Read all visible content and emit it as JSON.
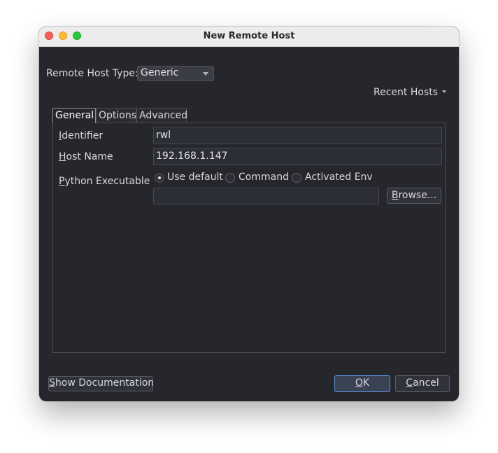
{
  "window": {
    "title": "New Remote Host"
  },
  "host_type": {
    "label_prefix": "Remote Host Type:",
    "value": "Generic"
  },
  "recent_hosts": {
    "label": "Recent Hosts"
  },
  "tabs": [
    {
      "label": "General",
      "active": true
    },
    {
      "label": "Options",
      "active": false
    },
    {
      "label": "Advanced",
      "active": false
    }
  ],
  "general": {
    "identifier": {
      "mnemonic": "I",
      "rest": "dentifier",
      "value": "rwl"
    },
    "host_name": {
      "mnemonic": "H",
      "rest": "ost Name",
      "value": "192.168.1.147"
    },
    "python_executable": {
      "mnemonic": "P",
      "rest": "ython Executable",
      "options": [
        "Use default",
        "Command",
        "Activated Env"
      ],
      "selected": "Use default",
      "path_value": ""
    },
    "browse": {
      "mnemonic": "B",
      "rest": "rowse..."
    }
  },
  "footer": {
    "show_docs": {
      "mnemonic": "S",
      "rest": "how Documentation"
    },
    "ok": {
      "mnemonic": "O",
      "rest": "K"
    },
    "cancel": {
      "mnemonic": "C",
      "rest": "ancel"
    }
  },
  "colors": {
    "window_bg": "#25272d",
    "default_button_border": "#5b8fd4"
  }
}
